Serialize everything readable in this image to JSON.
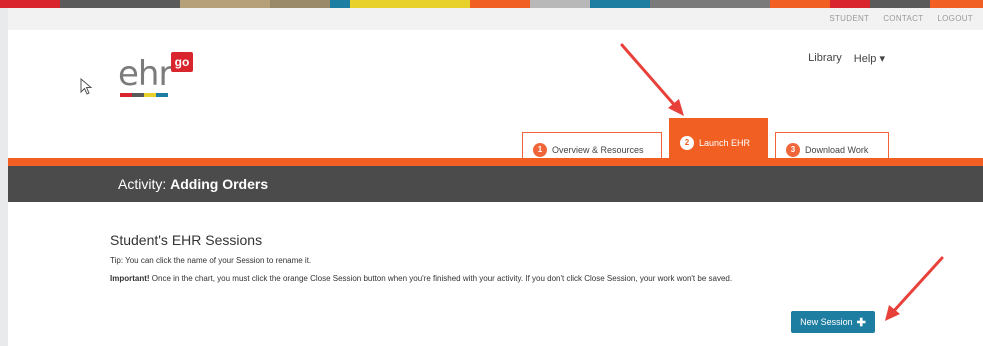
{
  "colors": {
    "accent_orange": "#f25f23",
    "dark_bar": "#4b4b4b",
    "button_blue": "#1e7ea1",
    "logo_red": "#d9262e",
    "annotation_red": "#e8413a"
  },
  "top_color_bar": [
    "#d9262e",
    "#5a5a5a",
    "#b5a07a",
    "#9a8a6a",
    "#1e7ea1",
    "#e8d12a",
    "#f25f23",
    "#b8b8b8",
    "#1e7ea1",
    "#7a7a7a",
    "#f25f23",
    "#d9262e",
    "#5a5a5a",
    "#f25f23"
  ],
  "utility_links": [
    "STUDENT",
    "CONTACT",
    "LOGOUT"
  ],
  "logo": {
    "text": "ehr",
    "badge": "go"
  },
  "top_nav": {
    "library": "Library",
    "help": "Help ▾"
  },
  "tabs": [
    {
      "number": "1",
      "label": "Overview & Resources",
      "active": false
    },
    {
      "number": "2",
      "label": "Launch EHR",
      "active": true
    },
    {
      "number": "3",
      "label": "Download Work",
      "active": false
    }
  ],
  "activity": {
    "prefix": "Activity:",
    "name": "Adding Orders"
  },
  "sessions": {
    "heading": "Student's EHR Sessions",
    "tip": "Tip: You can click the name of your Session to rename it.",
    "important_label": "Important!",
    "important_text": " Once in the chart, you must click the orange Close Session button when you're finished with your activity. If you don't click Close Session, your work won't be saved.",
    "new_session_label": "New Session",
    "new_session_icon": "plus-icon"
  }
}
